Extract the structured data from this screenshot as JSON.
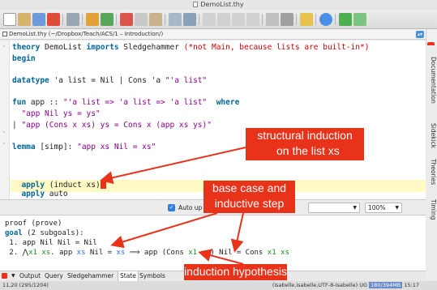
{
  "window": {
    "title": "DemoList.thy"
  },
  "pathbar": {
    "text": "DemoList.thy (~/Dropbox/Teach/ACS/1 – Introduction/)"
  },
  "editor": {
    "l1": {
      "kw": "theory",
      "name": " DemoList ",
      "kw2": "imports",
      "imp": " Sledgehammer ",
      "cmt": "(*not Main, because lists are built-in*)"
    },
    "l2": {
      "kw": "begin"
    },
    "l3": {
      "kw": "datatype",
      "rest": " 'a list = Nil | Cons 'a ",
      "str": "\"'a list\""
    },
    "l4": {
      "kw": "fun",
      "rest": " app :: ",
      "str": "\"'a list => 'a list => 'a list\"",
      "kw2": "  where"
    },
    "l5": {
      "str": "  \"app Nil ys = ys\""
    },
    "l6": {
      "rest": "| ",
      "str": "\"app (Cons x xs) ys = Cons x (app xs ys)\""
    },
    "l7": {
      "kw": "lemma",
      "rest": " [simp]: ",
      "str": "\"app xs Nil = xs\""
    },
    "l8": {
      "kw": "  apply",
      "rest": " (induct xs)"
    },
    "l9": {
      "kw": "  apply",
      "rest": " auto"
    }
  },
  "midbar": {
    "auto_update_label": "Auto up",
    "zoom_value": "100%"
  },
  "output": {
    "o1": "proof (prove)",
    "o2": {
      "kw": "goal",
      "rest": " (2 subgoals):"
    },
    "o3": " 1. app Nil Nil = Nil",
    "o4": {
      "a": " 2. ⋀",
      "b": "x1 xs",
      "c": ". app ",
      "d": "xs",
      "e": " Nil = ",
      "f": "xs",
      "g": " ⟹ app (Cons ",
      "h": "x1 xs",
      "i": ") Nil = Cons ",
      "j": "x1 xs"
    }
  },
  "bottom_tabs": [
    "Output",
    "Query",
    "Sledgehammer",
    "State",
    "Symbols"
  ],
  "side_tabs": [
    "Documentation",
    "Sidekick",
    "Theories",
    "Timing"
  ],
  "status": {
    "position": "11,20 (295/1204)",
    "right_text": "(isabelle,isabelle,UTF-8-Isabelle)",
    "mode": "UG",
    "memory": "180/394MB",
    "time": "15:17"
  },
  "callouts": {
    "induction": "structural induction\n  on the list xs",
    "base": "base case and\ninductive step",
    "hypothesis": "induction hypothesis"
  },
  "colors": {
    "callout": "#e8321a",
    "keyword": "#006699",
    "string": "#8b008b",
    "comment": "#cc0000"
  }
}
